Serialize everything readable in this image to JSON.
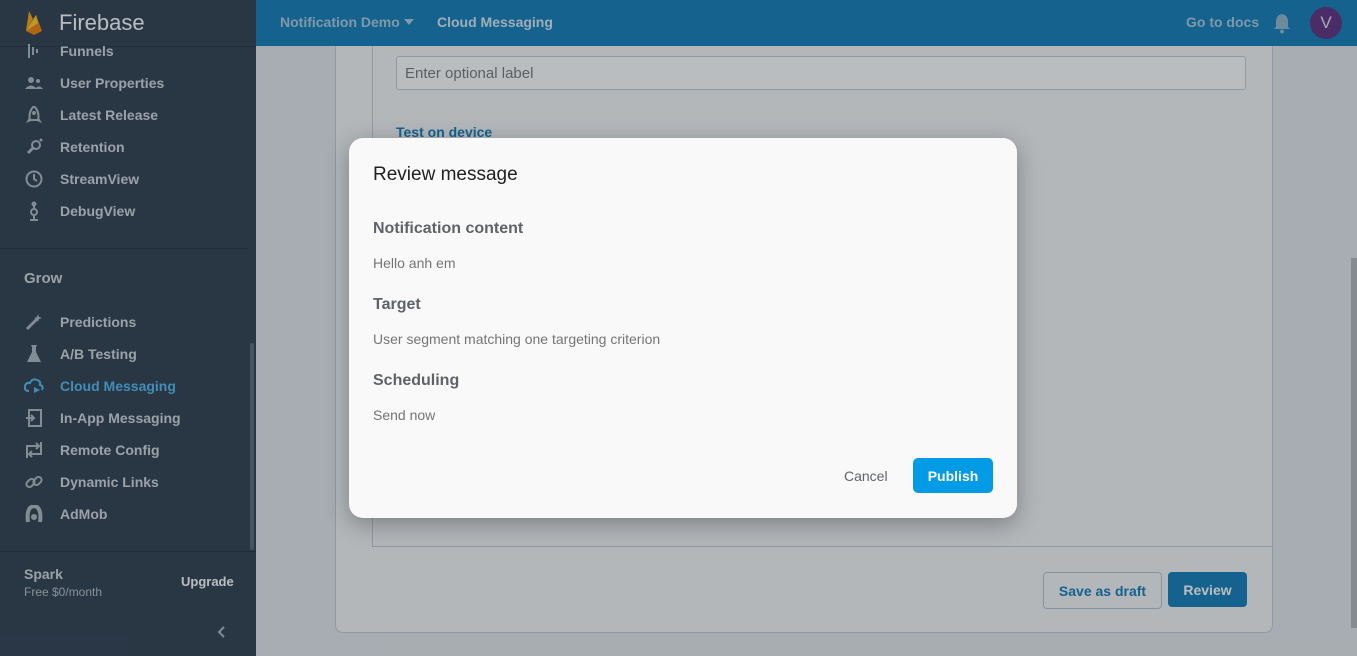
{
  "app": {
    "brand": "Firebase"
  },
  "sidebar": {
    "items_top": [
      {
        "label": "Funnels",
        "icon": "funnels-icon"
      },
      {
        "label": "User Properties",
        "icon": "user-properties-icon"
      },
      {
        "label": "Latest Release",
        "icon": "rocket-icon"
      },
      {
        "label": "Retention",
        "icon": "retention-icon"
      },
      {
        "label": "StreamView",
        "icon": "clock-icon"
      },
      {
        "label": "DebugView",
        "icon": "debug-icon"
      }
    ],
    "section_grow": "Grow",
    "items_grow": [
      {
        "label": "Predictions",
        "icon": "magic-wand-icon"
      },
      {
        "label": "A/B Testing",
        "icon": "flask-icon"
      },
      {
        "label": "Cloud Messaging",
        "icon": "cloud-messaging-icon",
        "active": true
      },
      {
        "label": "In-App Messaging",
        "icon": "in-app-messaging-icon"
      },
      {
        "label": "Remote Config",
        "icon": "remote-config-icon"
      },
      {
        "label": "Dynamic Links",
        "icon": "link-icon"
      },
      {
        "label": "AdMob",
        "icon": "admob-icon"
      }
    ],
    "plan": {
      "name": "Spark",
      "price": "Free $0/month",
      "upgrade": "Upgrade"
    }
  },
  "topbar": {
    "project": "Notification Demo",
    "page": "Cloud Messaging",
    "docs": "Go to docs",
    "avatar_letter": "V"
  },
  "form": {
    "label_placeholder": "Enter optional label",
    "test_link": "Test on device",
    "save_draft": "Save as draft",
    "review": "Review"
  },
  "dialog": {
    "title": "Review message",
    "sections": [
      {
        "heading": "Notification content",
        "value": "Hello anh em"
      },
      {
        "heading": "Target",
        "value": "User segment matching one targeting criterion"
      },
      {
        "heading": "Scheduling",
        "value": "Send now"
      }
    ],
    "cancel": "Cancel",
    "publish": "Publish"
  },
  "colors": {
    "sidebar_bg": "#2a3a4b",
    "topbar_bg": "#0b79b4",
    "active_link": "#4fb8f0",
    "publish_bg": "#039be5"
  }
}
